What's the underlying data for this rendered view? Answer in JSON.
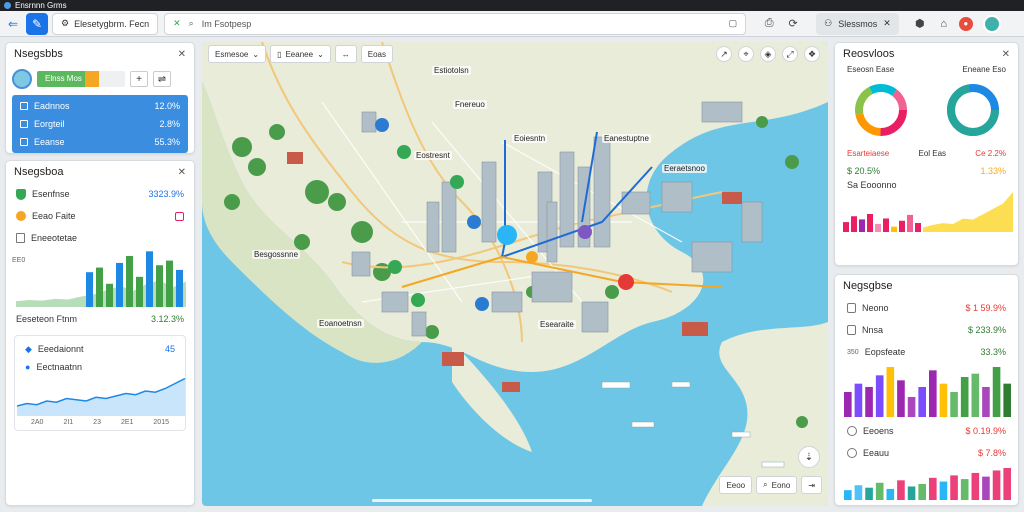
{
  "titlebar": {
    "title": "Ensrnnn Grms"
  },
  "tabbar": {
    "tab_label": "Elesetygbrm. Fecn",
    "url_text": "Im Fsotpesp",
    "account_pill": "Slessmos"
  },
  "left_top": {
    "title": "Nsegsbbs",
    "progress_label": "Elnss Mos",
    "progress_green": 0.55,
    "progress_orange": 0.16,
    "rows": [
      {
        "label": "Eadnnos",
        "value": "12.0%"
      },
      {
        "label": "Eorgteil",
        "value": "2.8%"
      },
      {
        "label": "Eeanse",
        "value": "55.3%"
      }
    ]
  },
  "left_bottom": {
    "title": "Nsegsboa",
    "stats": [
      {
        "label": "Esenfnse",
        "value": "3323.9%"
      },
      {
        "label": "Eeao Faite",
        "value": ""
      },
      {
        "label": "Eneeotetae",
        "value": ""
      }
    ],
    "chart_axis": "EE0",
    "chart_footer_label": "Eeseteon Ftnm",
    "chart_footer_value": "3.12.3%",
    "line_card": {
      "rows": [
        {
          "label": "Eeedaionnt",
          "value": "45"
        },
        {
          "label": "Eectnaatnn",
          "value": ""
        }
      ],
      "x_labels": [
        "2A0",
        "2I1",
        "23",
        "2E1",
        "2015"
      ]
    }
  },
  "map": {
    "toolbar": [
      {
        "label": "Esmesoe"
      },
      {
        "label": "Eeanee"
      },
      {
        "label": "↔"
      },
      {
        "label": "Eoas"
      }
    ],
    "labels": [
      {
        "text": "Estiotolsn"
      },
      {
        "text": "Fnereuo"
      },
      {
        "text": "Eostresnt"
      },
      {
        "text": "Eoiesntn"
      },
      {
        "text": "Eanestuptne"
      },
      {
        "text": "Eeraetsnoo"
      },
      {
        "text": "Besgossnne"
      },
      {
        "text": "Eoanoetnsn"
      },
      {
        "text": "Esearaite"
      }
    ],
    "zoom_buttons": [
      "Eeoo",
      "Eono"
    ]
  },
  "right_top": {
    "title": "Reosvloos",
    "donut_labels": [
      "Eseosn Ease",
      "Eneane Eso"
    ],
    "legend_left": "Esarteiaese",
    "legend_mid": "Eol Eas",
    "legend_right": "Ce 2.2%",
    "value_left": "$ 20.5%",
    "value_right": "1.33%",
    "bar_label": "Sa Eooonno",
    "bar_values": [
      22,
      35,
      28,
      40,
      18,
      30,
      12,
      25,
      38,
      20
    ],
    "bar_colors": [
      "#e91e63",
      "#e91e63",
      "#9c27b0",
      "#e91e63",
      "#f48fb1",
      "#e91e63",
      "#ffc107",
      "#e91e63",
      "#f06292",
      "#e91e63"
    ],
    "area_values": [
      5,
      8,
      10,
      9,
      15,
      14,
      20,
      26,
      32,
      45
    ]
  },
  "right_bottom": {
    "title": "Negsgbse",
    "rows": [
      {
        "label": "Neono",
        "value": "$ 1 59.9%",
        "color": "#e53935"
      },
      {
        "label": "Nnsa",
        "value": "$ 233.9%",
        "color": "#2e7d32"
      },
      {
        "label": "Eopsfeate",
        "value": "33.3%",
        "color": "#2e7d32"
      }
    ],
    "bar_values": [
      15,
      20,
      18,
      25,
      30,
      22,
      12,
      18,
      28,
      20,
      15,
      24,
      26,
      18,
      30,
      20
    ],
    "bar_colors": [
      "#9c27b0",
      "#7c4dff",
      "#9c27b0",
      "#7c4dff",
      "#ffc107",
      "#9c27b0",
      "#ab47bc",
      "#7c4dff",
      "#9c27b0",
      "#ffc107",
      "#66bb6a",
      "#43a047",
      "#66bb6a",
      "#ab47bc",
      "#43a047",
      "#2e7d32"
    ],
    "bar_axis": "350",
    "row2": [
      {
        "label": "Eeoens",
        "value": "$ 0.19.9%",
        "color": "#e53935"
      },
      {
        "label": "Eeauu",
        "value": "$ 7.8%",
        "color": "#e53935"
      }
    ],
    "bar2_values": [
      8,
      12,
      10,
      14,
      9,
      16,
      11,
      13,
      18,
      15,
      20,
      17,
      22,
      19,
      24,
      26
    ],
    "bar2_colors": [
      "#29b6f6",
      "#4fc3f7",
      "#26a69a",
      "#66bb6a",
      "#29b6f6",
      "#ec407a",
      "#26a69a",
      "#66bb6a",
      "#ec407a",
      "#29b6f6",
      "#ec407a",
      "#66bb6a",
      "#ec407a",
      "#ab47bc",
      "#ec407a",
      "#ec407a"
    ]
  },
  "colors": {
    "accent": "#1a73e8",
    "green": "#34a853",
    "orange": "#f5a623",
    "red": "#e53935"
  }
}
